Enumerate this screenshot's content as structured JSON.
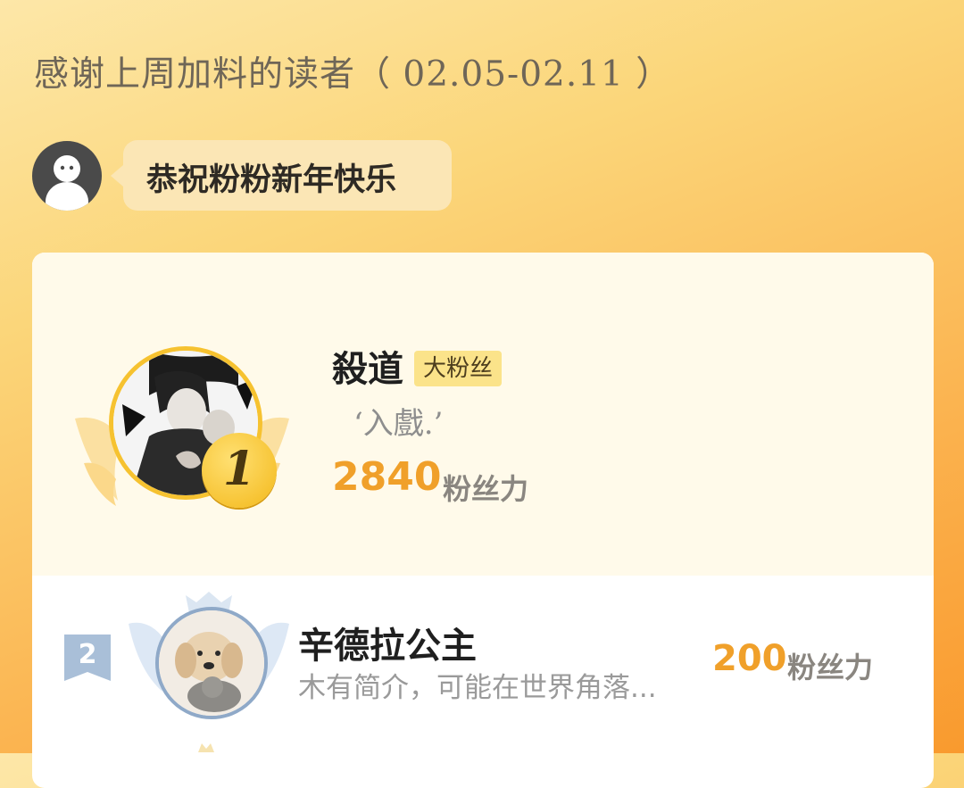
{
  "header": {
    "title": "感谢上周加料的读者（ 02.05-02.11 ）"
  },
  "greeting": {
    "message": "恭祝粉粉新年快乐"
  },
  "ranking": [
    {
      "rank": "1",
      "name": "殺道",
      "tag": "大粉丝",
      "motto": "‘入戲.’",
      "score": "2840",
      "unit": "粉丝力"
    },
    {
      "rank": "2",
      "name": "辛德拉公主",
      "bio": "木有简介，可能在世界角落...",
      "score": "200",
      "unit": "粉丝力"
    }
  ],
  "colors": {
    "accent": "#f0a02a",
    "gold": "#f6c230",
    "silver": "#8fa9c8"
  },
  "icons": [
    "crown-icon",
    "wings-icon",
    "medal-icon",
    "ribbon-icon",
    "user-avatar-icon"
  ]
}
